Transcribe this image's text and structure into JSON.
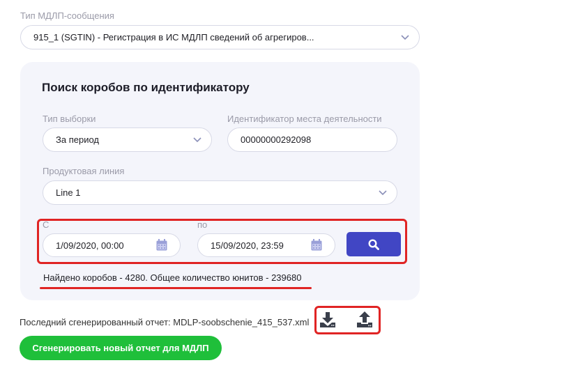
{
  "message_type": {
    "label": "Тип МДЛП-сообщения",
    "value": "915_1 (SGTIN) - Регистрация в ИС МДЛП сведений об агрегиров..."
  },
  "search": {
    "title": "Поиск коробов по идентификатору",
    "selection_type": {
      "label": "Тип выборки",
      "value": "За период"
    },
    "activity_place_id": {
      "label": "Идентификатор места деятельности",
      "value": "00000000292098"
    },
    "product_line": {
      "label": "Продуктовая линия",
      "value": "Line 1"
    },
    "date_from": {
      "label": "С",
      "value": "1/09/2020, 00:00"
    },
    "date_to": {
      "label": "по",
      "value": "15/09/2020, 23:59"
    },
    "result_text": "Найдено коробов - 4280. Общее количество юнитов - 239680"
  },
  "report": {
    "last_generated": "Последний сгенерированный отчет: MDLP-soobschenie_415_537.xml",
    "generate_button": "Сгенерировать новый отчет для МДЛП"
  },
  "colors": {
    "primary": "#4146c4",
    "success": "#1fbf3a",
    "highlight": "#e02424",
    "panel_bg": "#f4f5fb"
  },
  "icons": [
    "chevron-down-icon",
    "calendar-icon",
    "search-icon",
    "download-icon",
    "upload-icon"
  ]
}
